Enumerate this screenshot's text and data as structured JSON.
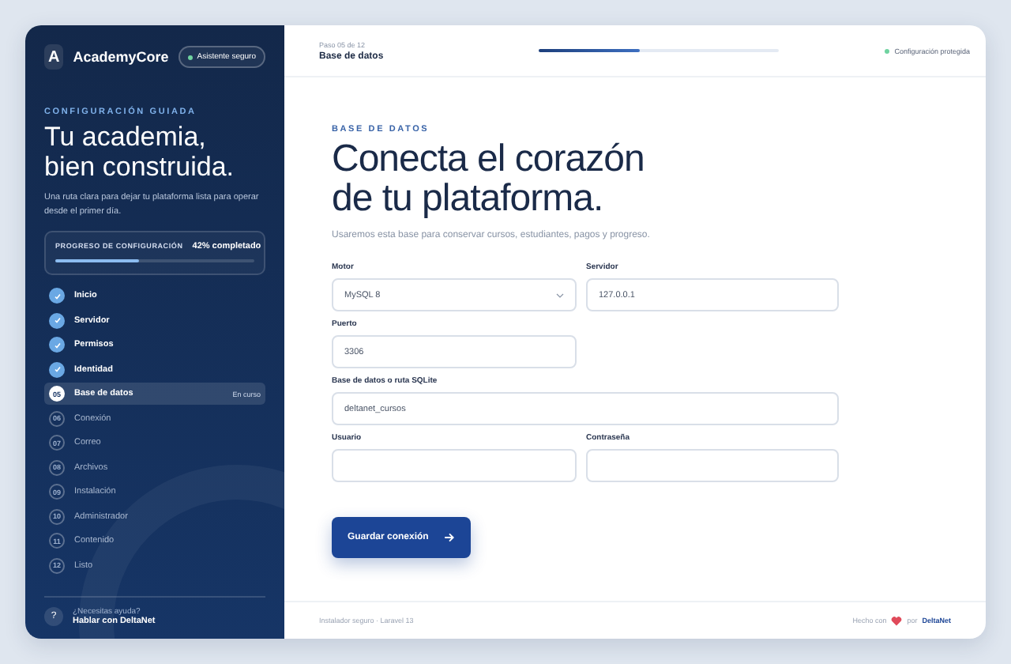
{
  "sidebar": {
    "brand": {
      "letter": "A",
      "name": "AcademyCore"
    },
    "badge": "Asistente seguro",
    "eyebrow": "CONFIGURACIÓN GUIADA",
    "title_lines": [
      "Tu academia,",
      "bien construida."
    ],
    "lead": "Una ruta clara para dejar tu plataforma lista para operar desde el primer día.",
    "progress": {
      "label": "PROGRESO DE CONFIGURACIÓN",
      "reading": "42% completado",
      "level": 0.42
    },
    "steps": [
      {
        "label": "Inicio",
        "done": true,
        "selected": false
      },
      {
        "label": "Servidor",
        "done": true,
        "selected": false
      },
      {
        "label": "Permisos",
        "done": true,
        "selected": false
      },
      {
        "label": "Identidad",
        "done": true,
        "selected": false
      },
      {
        "number": "05",
        "label": "Base de datos",
        "done": false,
        "selected": true,
        "tag": "En curso"
      },
      {
        "number": "06",
        "label": "Conexión",
        "done": false,
        "selected": false
      },
      {
        "number": "07",
        "label": "Correo",
        "done": false,
        "selected": false
      },
      {
        "number": "08",
        "label": "Archivos",
        "done": false,
        "selected": false
      },
      {
        "number": "09",
        "label": "Instalación",
        "done": false,
        "selected": false
      },
      {
        "number": "10",
        "label": "Administrador",
        "done": false,
        "selected": false
      },
      {
        "number": "11",
        "label": "Contenido",
        "done": false,
        "selected": false
      },
      {
        "number": "12",
        "label": "Listo",
        "done": false,
        "selected": false
      }
    ],
    "help": {
      "icon": "?",
      "question": "¿Necesitas ayuda?",
      "link": "Hablar con DeltaNet"
    }
  },
  "topbar": {
    "step": "Paso 05 de 12",
    "title": "Base de datos",
    "level": 0.42,
    "secure": "Configuración protegida"
  },
  "main": {
    "eyebrow": "BASE DE DATOS",
    "title_lines": [
      "Conecta el corazón",
      "de tu plataforma."
    ],
    "lead": "Usaremos esta base para conservar cursos, estudiantes, pagos y progreso.",
    "fields": [
      {
        "kind": "select",
        "label": "Motor",
        "value": "MySQL 8",
        "full": false
      },
      {
        "kind": "text",
        "label": "Servidor",
        "value": "127.0.0.1",
        "full": false
      },
      {
        "kind": "text",
        "label": "Puerto",
        "value": "3306",
        "full": false
      },
      {
        "kind": "text",
        "label": "Base de datos o ruta SQLite",
        "value": "deltanet_cursos",
        "full": true
      },
      {
        "kind": "text",
        "label": "Usuario",
        "full": false
      },
      {
        "kind": "password",
        "label": "Contraseña",
        "full": false
      }
    ],
    "button": "Guardar conexión"
  },
  "footer": {
    "left": "Instalador seguro · Laravel 13",
    "made": "Hecho con",
    "by": "por",
    "brand": "DeltaNet"
  }
}
